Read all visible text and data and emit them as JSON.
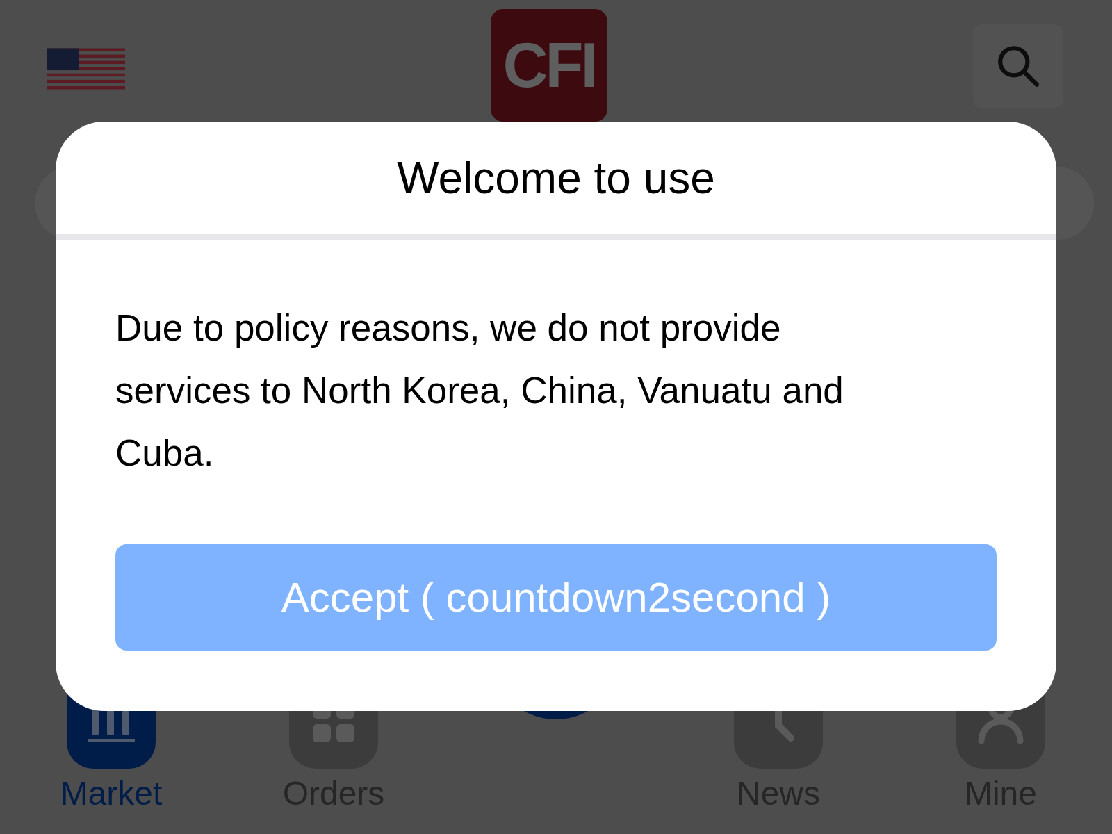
{
  "header": {
    "logo_text": "CFI"
  },
  "dialog": {
    "title": "Welcome to use",
    "message": "Due to policy reasons, we do not provide services to North Korea, China, Vanuatu and Cuba.",
    "accept_button": "Accept ( countdown2second )"
  },
  "tab_bar": [
    {
      "label": "Market",
      "selected": true
    },
    {
      "label": "Orders",
      "selected": false
    },
    {
      "label": "News",
      "selected": false
    },
    {
      "label": "Mine",
      "selected": false
    }
  ]
}
